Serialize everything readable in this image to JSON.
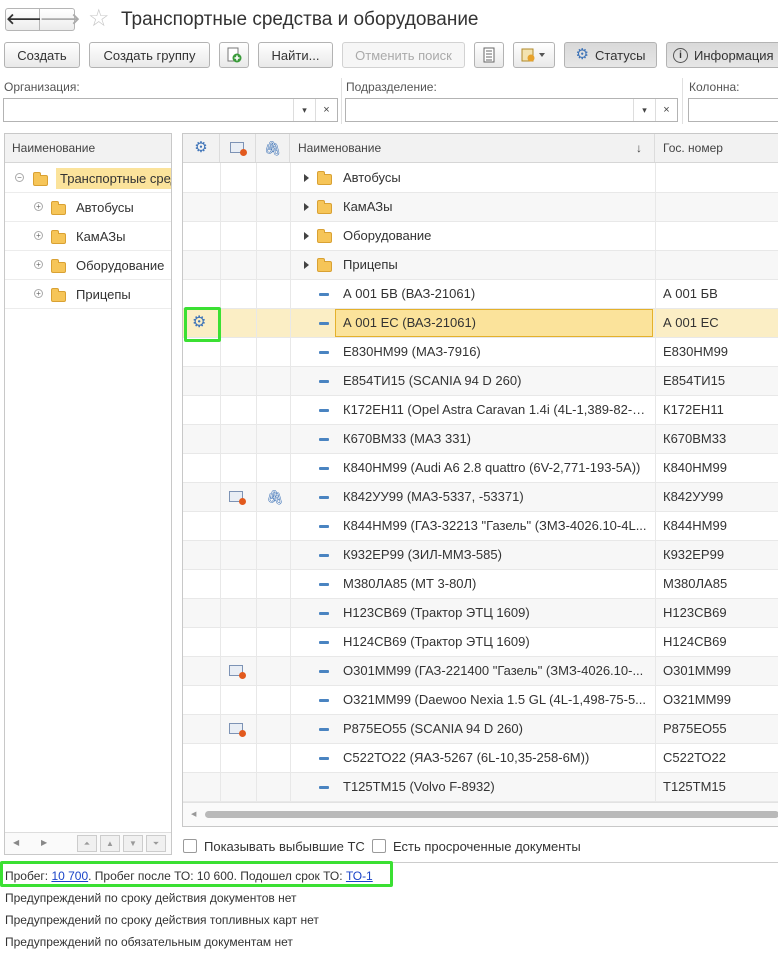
{
  "header": {
    "back_icon": "arrow-left-icon",
    "forward_icon": "arrow-right-icon",
    "favorite_icon": "star-icon",
    "title": "Транспортные средства и оборудование"
  },
  "toolbar": {
    "create": "Создать",
    "create_group": "Создать группу",
    "find": "Найти...",
    "cancel_search": "Отменить поиск",
    "statuses": "Статусы",
    "information": "Информация"
  },
  "filters": {
    "organization_label": "Организация:",
    "subdivision_label": "Подразделение:",
    "column_label": "Колонна:",
    "dropdown_glyph": "▾",
    "clear_glyph": "×"
  },
  "tree": {
    "header": "Наименование",
    "root": "Транспортные средства",
    "items": [
      "Автобусы",
      "КамАЗы",
      "Оборудование",
      "Прицепы"
    ]
  },
  "grid": {
    "col_name": "Наименование",
    "col_plate": "Гос. номер",
    "sort_glyph": "↓",
    "groups": [
      "Автобусы",
      "КамАЗы",
      "Оборудование",
      "Прицепы"
    ],
    "rows": [
      {
        "name": "А 001 БВ (ВАЗ-21061)",
        "plate": "А 001 БВ",
        "status": false,
        "doc": false,
        "clip": false
      },
      {
        "name": "А 001 ЕС (ВАЗ-21061)",
        "plate": "А 001 ЕС",
        "status": true,
        "doc": false,
        "clip": false,
        "selected": true
      },
      {
        "name": "Е830НМ99 (МАЗ-7916)",
        "plate": "Е830НМ99",
        "status": false,
        "doc": false,
        "clip": false
      },
      {
        "name": "Е854ТИ15 (SCANIA 94 D 260)",
        "plate": "Е854ТИ15",
        "status": false,
        "doc": false,
        "clip": false
      },
      {
        "name": "К172ЕН11 (Opel Astra Caravan 1.4i (4L-1,389-82-5...",
        "plate": "К172ЕН11",
        "status": false,
        "doc": false,
        "clip": false
      },
      {
        "name": "К670ВМ33 (МАЗ 331)",
        "plate": "К670ВМ33",
        "status": false,
        "doc": false,
        "clip": false
      },
      {
        "name": "К840НМ99 (Audi A6 2.8 quattro (6V-2,771-193-5A))",
        "plate": "К840НМ99",
        "status": false,
        "doc": false,
        "clip": false
      },
      {
        "name": "К842УУ99 (МАЗ-5337, -53371)",
        "plate": "К842УУ99",
        "status": false,
        "doc": true,
        "clip": true
      },
      {
        "name": "К844НМ99 (ГАЗ-32213 \"Газель\" (ЗМЗ-4026.10-4L...",
        "plate": "К844НМ99",
        "status": false,
        "doc": false,
        "clip": false
      },
      {
        "name": "К932ЕР99 (ЗИЛ-ММЗ-585)",
        "plate": "К932ЕР99",
        "status": false,
        "doc": false,
        "clip": false
      },
      {
        "name": "М380ЛА85 (МТ 3-80Л)",
        "plate": "М380ЛА85",
        "status": false,
        "doc": false,
        "clip": false
      },
      {
        "name": "Н123СВ69 (Трактор ЭТЦ 1609)",
        "plate": "Н123СВ69",
        "status": false,
        "doc": false,
        "clip": false
      },
      {
        "name": "Н124СВ69 (Трактор ЭТЦ 1609)",
        "plate": "Н124СВ69",
        "status": false,
        "doc": false,
        "clip": false
      },
      {
        "name": "О301ММ99 (ГАЗ-221400 \"Газель\" (ЗМЗ-4026.10-...",
        "plate": "О301ММ99",
        "status": false,
        "doc": true,
        "clip": false
      },
      {
        "name": "О321ММ99 (Daewoo Nexia 1.5 GL (4L-1,498-75-5...",
        "plate": "О321ММ99",
        "status": false,
        "doc": false,
        "clip": false
      },
      {
        "name": "Р875ЕО55 (SCANIA 94 D 260)",
        "plate": "Р875ЕО55",
        "status": false,
        "doc": true,
        "clip": false
      },
      {
        "name": "С522ТО22 (ЯАЗ-5267 (6L-10,35-258-6М))",
        "plate": "С522ТО22",
        "status": false,
        "doc": false,
        "clip": false
      },
      {
        "name": "Т125ТМ15 (Volvo F-8932)",
        "plate": "Т125ТМ15",
        "status": false,
        "doc": false,
        "clip": false
      }
    ]
  },
  "checkboxes": {
    "show_retired": "Показывать выбывшие ТС",
    "overdue_docs": "Есть просроченные документы"
  },
  "info": {
    "mileage_label": "Пробег: ",
    "mileage_value": "10 700",
    "after_service": ". Пробег после ТО: 10 600. Подошел срок ТО: ",
    "service_link": "ТО-1",
    "line2": "Предупреждений по сроку действия документов нет",
    "line3": "Предупреждений по сроку действия топливных карт нет",
    "line4": "Предупреждений по обязательным документам нет"
  },
  "colors": {
    "selection": "#fbeec5",
    "selection_border": "#e4b12c",
    "highlight": "#3be033",
    "link": "#1a44c8",
    "icon_blue": "#3f74b8"
  }
}
